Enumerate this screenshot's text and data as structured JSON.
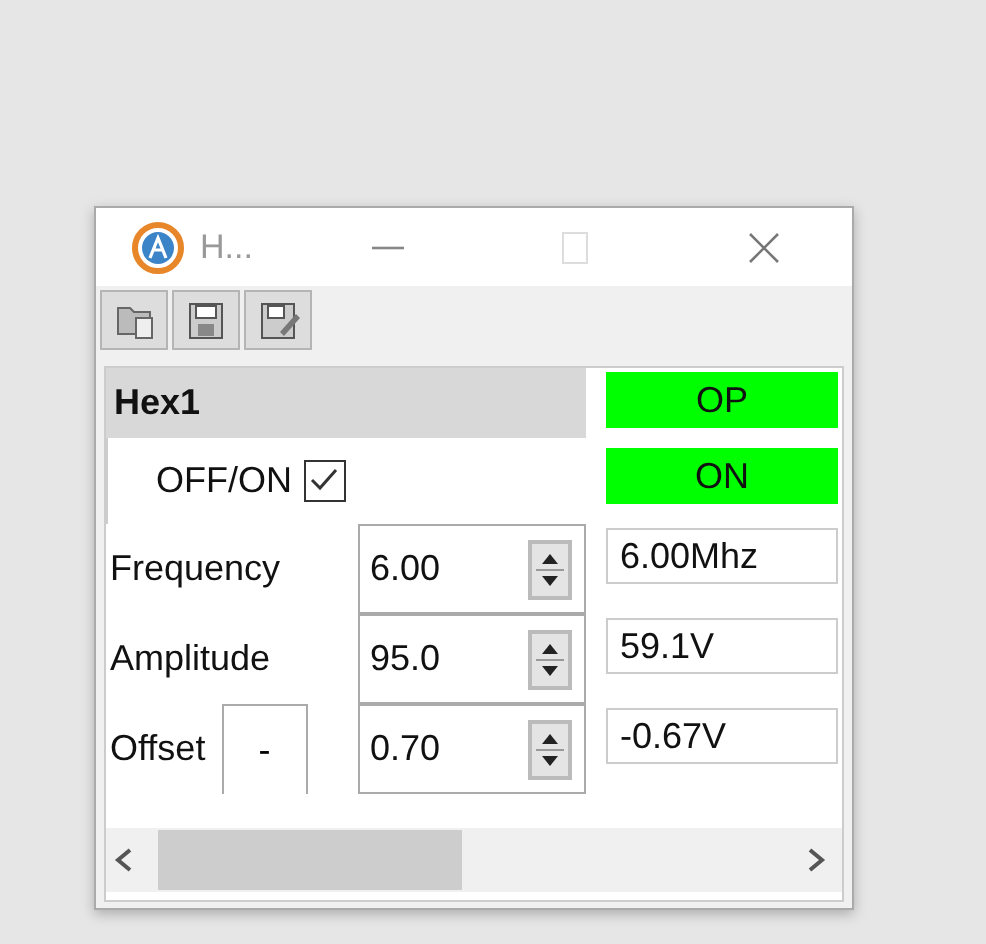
{
  "window": {
    "title": "H..."
  },
  "panel": {
    "title": "Hex1"
  },
  "controls": [
    {
      "kind": "checkbox",
      "label": "OFF/ON",
      "checked": true
    },
    {
      "kind": "spin",
      "label": "Frequency",
      "value": "6.00"
    },
    {
      "kind": "spin",
      "label": "Amplitude",
      "value": "95.0"
    },
    {
      "kind": "spin",
      "label": "Offset",
      "sign": "-",
      "value": "0.70"
    }
  ],
  "indicators": [
    {
      "text": "OP",
      "color": "#00ff00"
    },
    {
      "text": "ON",
      "color": "#00ff00"
    },
    {
      "text": "6.00Mhz"
    },
    {
      "text": "59.1V"
    },
    {
      "text": "-0.67V"
    }
  ]
}
